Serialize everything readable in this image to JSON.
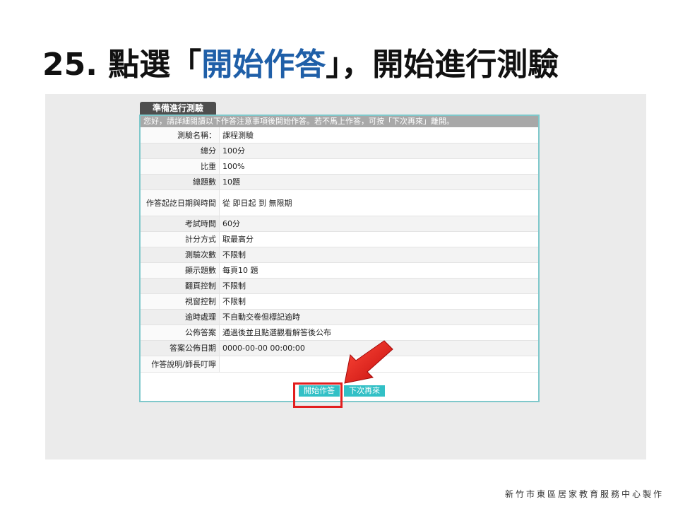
{
  "slide": {
    "title_prefix": "25. 點選「",
    "title_highlight": "開始作答",
    "title_suffix": "」，開始進行測驗",
    "footer": "新竹市東區居家教育服務中心製作"
  },
  "panel": {
    "tab_label": "準備進行測驗",
    "notice": "您好，請詳細閱讀以下作答注意事項後開始作答。若不馬上作答，可按「下次再來」離開。",
    "rows": [
      {
        "label": "測驗名稱：",
        "value": "課程測驗"
      },
      {
        "label": "總分",
        "value": "100分"
      },
      {
        "label": "比重",
        "value": "100%"
      },
      {
        "label": "總題數",
        "value": "10題"
      },
      {
        "label": "作答起訖日期與時間",
        "value": "從 即日起 到 無限期"
      },
      {
        "label": "考試時間",
        "value": "60分"
      },
      {
        "label": "計分方式",
        "value": "取最高分"
      },
      {
        "label": "測驗次數",
        "value": "不限制"
      },
      {
        "label": "顯示題數",
        "value": "每頁10 題"
      },
      {
        "label": "翻頁控制",
        "value": "不限制"
      },
      {
        "label": "視窗控制",
        "value": "不限制"
      },
      {
        "label": "逾時處理",
        "value": "不自動交卷但標記逾時"
      },
      {
        "label": "公佈答案",
        "value": "通過後並且點選觀看解答後公布"
      },
      {
        "label": "答案公佈日期",
        "value": "0000-00-00 00:00:00"
      },
      {
        "label": "作答說明/師長叮嚀",
        "value": ""
      }
    ],
    "buttons": {
      "start": "開始作答",
      "later": "下次再來"
    }
  },
  "colors": {
    "accent_teal": "#32c0c6",
    "highlight_red": "#e21e1e",
    "title_blue": "#1f5fa8"
  }
}
